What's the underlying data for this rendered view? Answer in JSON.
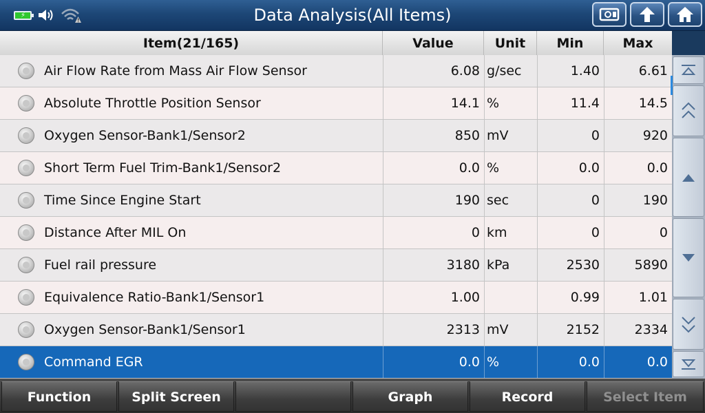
{
  "window": {
    "title": "Data Analysis(All Items)"
  },
  "status_icons": [
    "battery-charging-icon",
    "speaker-icon",
    "wifi-warning-icon"
  ],
  "top_buttons": [
    "screenshot-icon",
    "back-up-icon",
    "home-icon"
  ],
  "table": {
    "headers": {
      "item": "Item(21/165)",
      "value": "Value",
      "unit": "Unit",
      "min": "Min",
      "max": "Max"
    },
    "rows": [
      {
        "item": "Air Flow Rate from Mass Air Flow Sensor",
        "value": "6.08",
        "unit": "g/sec",
        "min": "1.40",
        "max": "6.61"
      },
      {
        "item": "Absolute Throttle Position Sensor",
        "value": "14.1",
        "unit": "%",
        "min": "11.4",
        "max": "14.5"
      },
      {
        "item": "Oxygen Sensor-Bank1/Sensor2",
        "value": "850",
        "unit": "mV",
        "min": "0",
        "max": "920"
      },
      {
        "item": "Short Term Fuel Trim-Bank1/Sensor2",
        "value": "0.0",
        "unit": "%",
        "min": "0.0",
        "max": "0.0"
      },
      {
        "item": "Time Since Engine Start",
        "value": "190",
        "unit": "sec",
        "min": "0",
        "max": "190"
      },
      {
        "item": "Distance After MIL On",
        "value": "0",
        "unit": "km",
        "min": "0",
        "max": "0"
      },
      {
        "item": "Fuel rail pressure",
        "value": "3180",
        "unit": "kPa",
        "min": "2530",
        "max": "5890"
      },
      {
        "item": "Equivalence Ratio-Bank1/Sensor1",
        "value": "1.00",
        "unit": "",
        "min": "0.99",
        "max": "1.01"
      },
      {
        "item": "Oxygen Sensor-Bank1/Sensor1",
        "value": "2313",
        "unit": "mV",
        "min": "2152",
        "max": "2334"
      },
      {
        "item": "Command EGR",
        "value": "0.0",
        "unit": "%",
        "min": "0.0",
        "max": "0.0"
      }
    ],
    "selected_index": 9
  },
  "scroll_buttons": [
    "scroll-top-icon",
    "page-up-icon",
    "line-up-icon",
    "line-down-icon",
    "page-down-icon",
    "scroll-bottom-icon"
  ],
  "bottom_bar": {
    "function": "Function",
    "split_screen": "Split Screen",
    "empty": "",
    "graph": "Graph",
    "record": "Record",
    "select_item": "Select Item"
  },
  "colors": {
    "selected_row": "#1668b9",
    "title_bar": "#1d4777",
    "battery": "#2fc82f"
  }
}
